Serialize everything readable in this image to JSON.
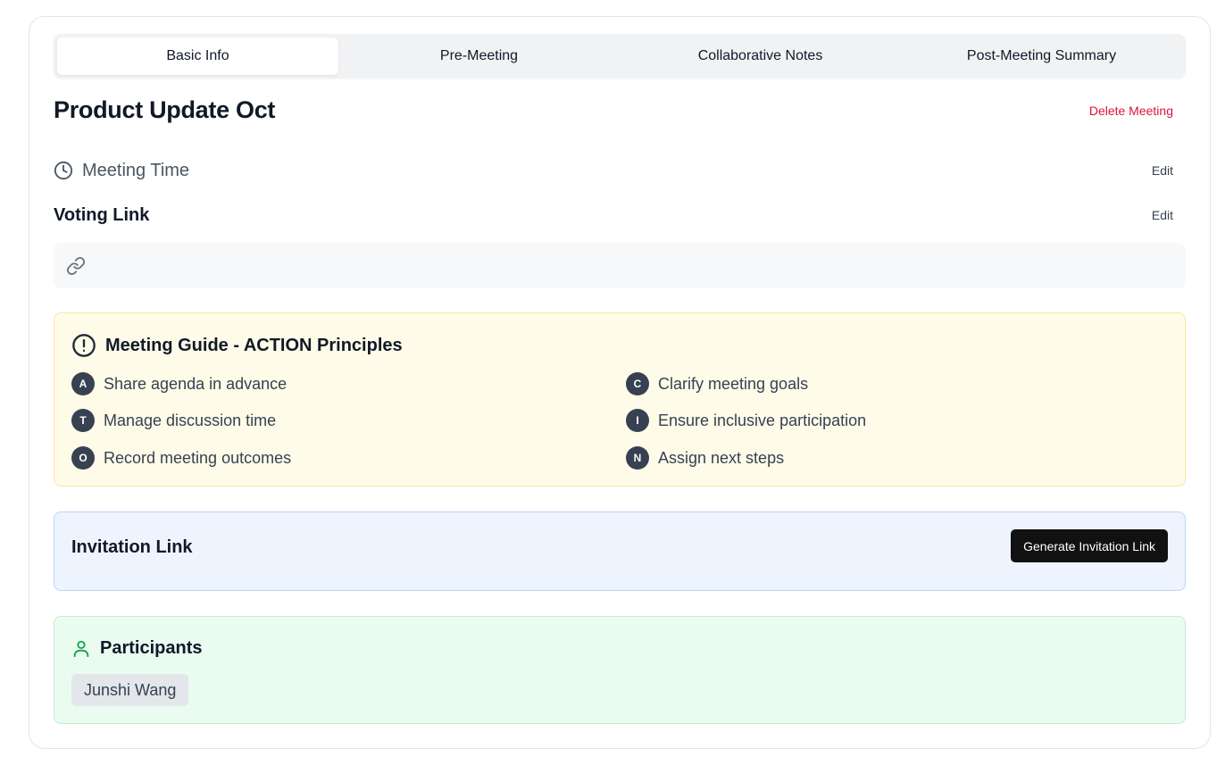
{
  "tabs": [
    {
      "label": "Basic Info",
      "active": true
    },
    {
      "label": "Pre-Meeting",
      "active": false
    },
    {
      "label": "Collaborative Notes",
      "active": false
    },
    {
      "label": "Post-Meeting Summary",
      "active": false
    }
  ],
  "meeting": {
    "title": "Product Update Oct",
    "delete_label": "Delete Meeting"
  },
  "meeting_time": {
    "label": "Meeting Time",
    "edit_label": "Edit",
    "icon": "clock-icon"
  },
  "voting_link": {
    "label": "Voting Link",
    "edit_label": "Edit",
    "value": "",
    "icon": "link-icon"
  },
  "guide": {
    "title": "Meeting Guide - ACTION Principles",
    "icon": "alert-circle-icon",
    "principles": [
      {
        "letter": "A",
        "text": "Share agenda in advance"
      },
      {
        "letter": "C",
        "text": "Clarify meeting goals"
      },
      {
        "letter": "T",
        "text": "Manage discussion time"
      },
      {
        "letter": "I",
        "text": "Ensure inclusive participation"
      },
      {
        "letter": "O",
        "text": "Record meeting outcomes"
      },
      {
        "letter": "N",
        "text": "Assign next steps"
      }
    ]
  },
  "invitation": {
    "title": "Invitation Link",
    "button_label": "Generate Invitation Link"
  },
  "participants": {
    "title": "Participants",
    "icon": "user-icon",
    "list": [
      "Junshi Wang"
    ]
  },
  "colors": {
    "danger": "#dc143c",
    "guide_bg": "#fefbe8",
    "invite_bg": "#edf4fe",
    "participants_bg": "#eafcf0",
    "participants_icon": "#16a34a"
  }
}
